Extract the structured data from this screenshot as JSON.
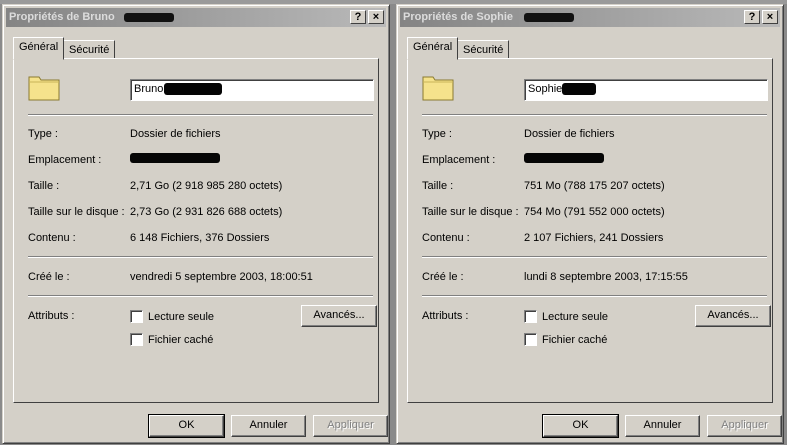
{
  "dialogs": [
    {
      "title": "Propriétés de Bruno",
      "help_btn": "?",
      "close_btn": "×",
      "tabs": [
        "Général",
        "Sécurité"
      ],
      "name_value": "Bruno",
      "labels": {
        "type": "Type :",
        "location": "Emplacement :",
        "size": "Taille :",
        "size_on_disk": "Taille sur le disque :",
        "contents": "Contenu :",
        "created": "Créé le :",
        "attributes": "Attributs :"
      },
      "values": {
        "type": "Dossier de fichiers",
        "size": "2,71 Go (2 918 985 280 octets)",
        "size_on_disk": "2,73 Go (2 931 826 688 octets)",
        "contents": "6 148 Fichiers, 376 Dossiers",
        "created": "vendredi 5 septembre 2003, 18:00:51"
      },
      "attributes": {
        "readonly_label": "Lecture seule",
        "hidden_label": "Fichier caché",
        "readonly_checked": false,
        "hidden_checked": false,
        "advanced_button": "Avancés..."
      },
      "buttons": {
        "ok": "OK",
        "cancel": "Annuler",
        "apply": "Appliquer"
      }
    },
    {
      "title": "Propriétés de Sophie",
      "help_btn": "?",
      "close_btn": "×",
      "tabs": [
        "Général",
        "Sécurité"
      ],
      "name_value": "Sophie",
      "labels": {
        "type": "Type :",
        "location": "Emplacement :",
        "size": "Taille :",
        "size_on_disk": "Taille sur le disque :",
        "contents": "Contenu :",
        "created": "Créé le :",
        "attributes": "Attributs :"
      },
      "values": {
        "type": "Dossier de fichiers",
        "size": "751 Mo (788 175 207 octets)",
        "size_on_disk": "754 Mo (791 552 000 octets)",
        "contents": "2 107 Fichiers, 241 Dossiers",
        "created": "lundi 8 septembre 2003, 17:15:55"
      },
      "attributes": {
        "readonly_label": "Lecture seule",
        "hidden_label": "Fichier caché",
        "readonly_checked": false,
        "hidden_checked": false,
        "advanced_button": "Avancés..."
      },
      "buttons": {
        "ok": "OK",
        "cancel": "Annuler",
        "apply": "Appliquer"
      }
    }
  ],
  "icons": {
    "folder": "folder-icon"
  },
  "colors": {
    "dialog_bg": "#d4d0c8",
    "titlebar_inactive": "#848484"
  }
}
